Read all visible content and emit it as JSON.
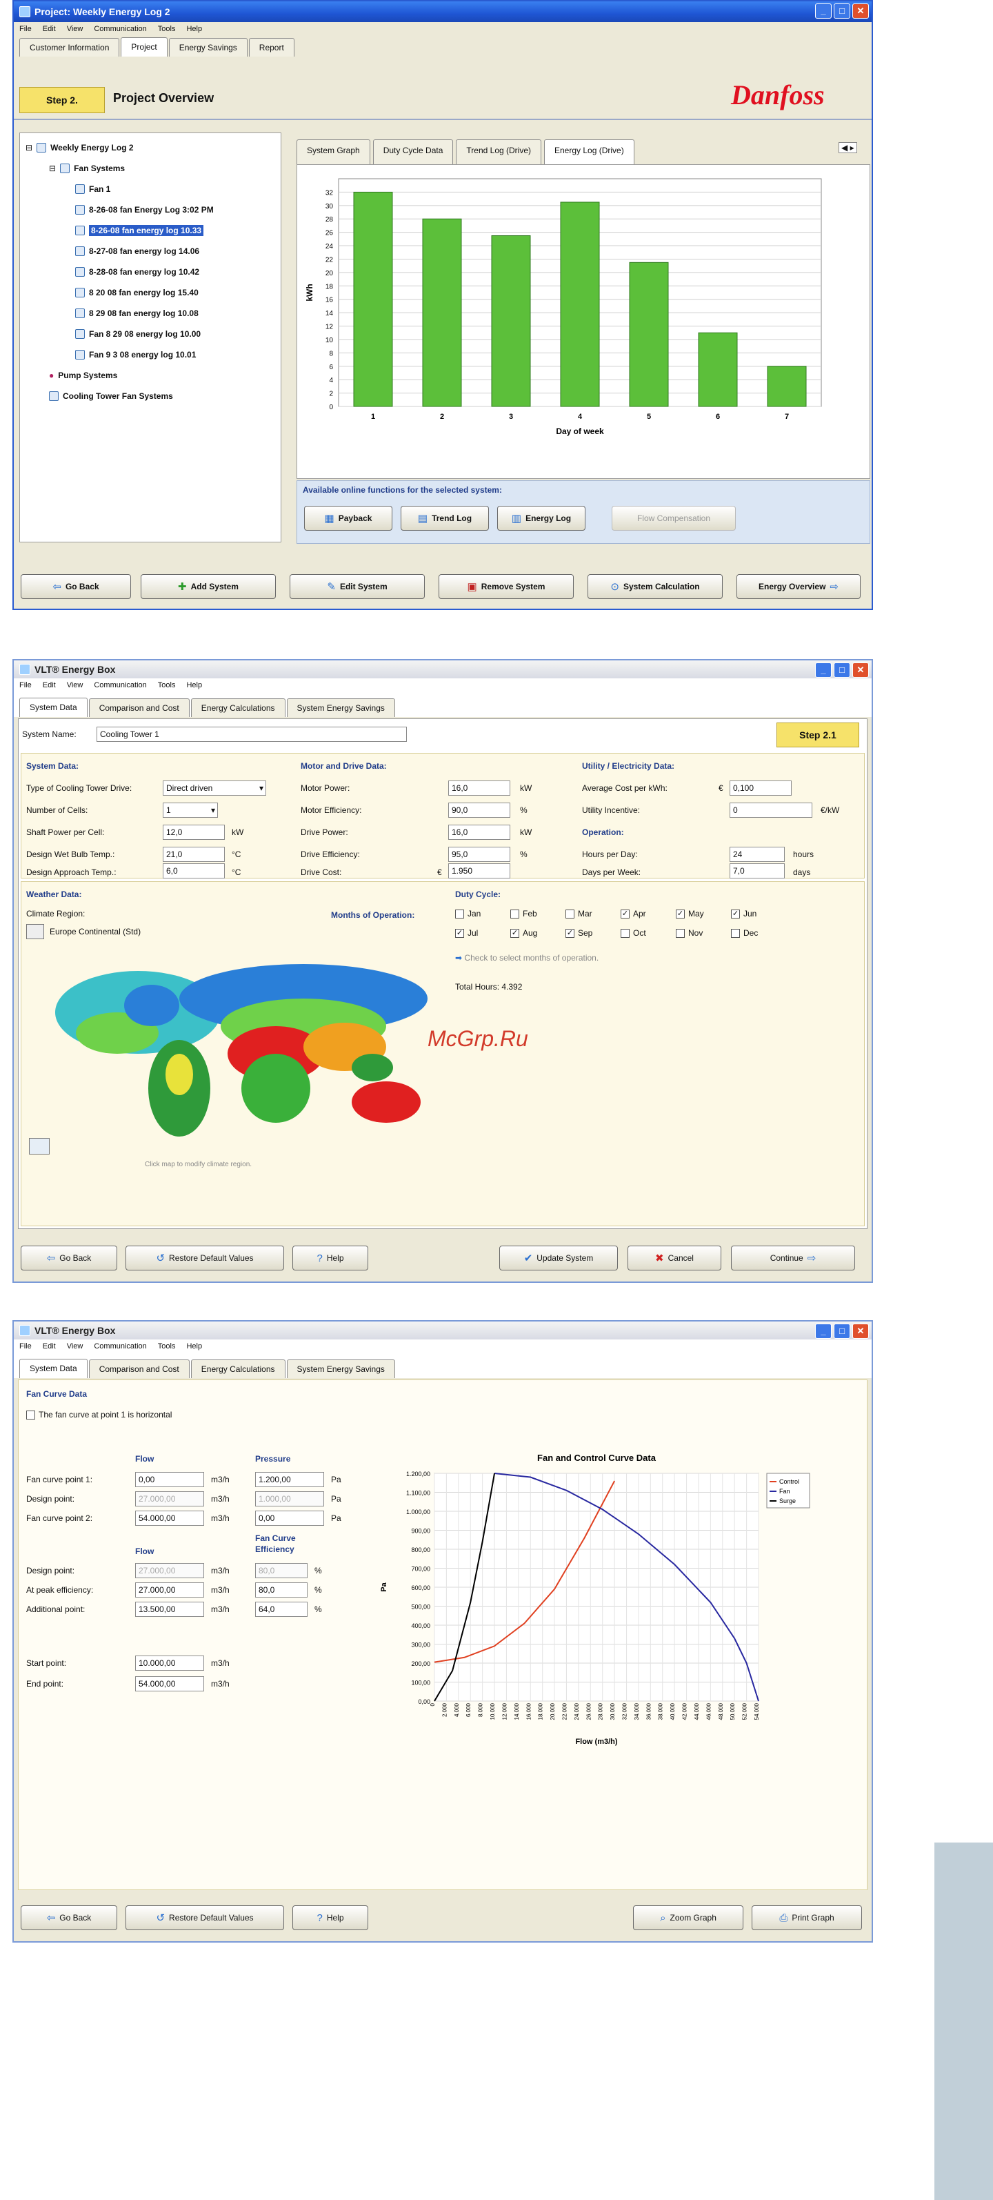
{
  "screen1": {
    "title": "Project: Weekly Energy Log 2",
    "menu": [
      "File",
      "Edit",
      "View",
      "Communication",
      "Tools",
      "Help"
    ],
    "tabs": [
      "Customer Information",
      "Project",
      "Energy Savings",
      "Report"
    ],
    "step": "Step 2.",
    "heading": "Project Overview",
    "logo": "Danfoss",
    "tree": {
      "root": "Weekly Energy Log 2",
      "fan_systems": "Fan Systems",
      "fan1": "Fan 1",
      "logs": [
        "8-26-08 fan Energy Log 3:02 PM",
        "8-26-08 fan energy log 10.33",
        "8-27-08 fan energy log 14.06",
        "8-28-08 fan energy log 10.42",
        "8 20 08 fan energy log 15.40",
        "8 29 08 fan energy log 10.08",
        "Fan 8 29 08 energy log 10.00",
        "Fan 9 3 08 energy log 10.01"
      ],
      "pump": "Pump Systems",
      "cooling": "Cooling Tower Fan Systems"
    },
    "graph_tabs": [
      "System Graph",
      "Duty Cycle Data",
      "Trend Log (Drive)",
      "Energy Log (Drive)"
    ],
    "functions_label": "Available online functions for the selected system:",
    "function_buttons": [
      "Payback",
      "Trend Log",
      "Energy Log",
      "Flow Compensation"
    ],
    "bottom_buttons": [
      "Go Back",
      "Add System",
      "Edit System",
      "Remove System",
      "System Calculation",
      "Energy Overview"
    ]
  },
  "chart_data": [
    {
      "type": "bar",
      "categories": [
        "1",
        "2",
        "3",
        "4",
        "5",
        "6",
        "7"
      ],
      "values": [
        32,
        28,
        25.5,
        30.5,
        21.5,
        11,
        6
      ],
      "xlabel": "Day of week",
      "ylabel": "kWh",
      "ylim": [
        0,
        34
      ],
      "yticks": [
        0,
        2,
        4,
        6,
        8,
        10,
        12,
        14,
        16,
        18,
        20,
        22,
        24,
        26,
        28,
        30,
        32
      ],
      "grid": true,
      "colors": {
        "bar": "#5cbf3a"
      }
    },
    {
      "type": "line",
      "title": "Fan and Control Curve Data",
      "xlabel": "Flow (m3/h)",
      "ylabel": "Pa",
      "xlim": [
        0,
        54000
      ],
      "ylim": [
        0,
        1200
      ],
      "xticks": [
        "0",
        "2.000",
        "4.000",
        "6.000",
        "8.000",
        "10.000",
        "12.000",
        "14.000",
        "16.000",
        "18.000",
        "20.000",
        "22.000",
        "24.000",
        "26.000",
        "28.000",
        "30.000",
        "32.000",
        "34.000",
        "36.000",
        "38.000",
        "40.000",
        "42.000",
        "44.000",
        "46.000",
        "48.000",
        "50.000",
        "52.000",
        "54.000"
      ],
      "yticks": [
        "0,00",
        "100,00",
        "200,00",
        "300,00",
        "400,00",
        "500,00",
        "600,00",
        "700,00",
        "800,00",
        "900,00",
        "1.000,00",
        "1.100,00",
        "1.200,00"
      ],
      "legend": "top-right",
      "series": [
        {
          "name": "Control",
          "color": "#e04020",
          "x": [
            0,
            5000,
            10000,
            15000,
            20000,
            25000,
            30000
          ],
          "y": [
            205,
            230,
            290,
            410,
            590,
            860,
            1160
          ]
        },
        {
          "name": "Fan",
          "color": "#2828a0",
          "x": [
            10000,
            16000,
            22000,
            28000,
            34000,
            40000,
            46000,
            50000,
            52000,
            54000
          ],
          "y": [
            1200,
            1180,
            1110,
            1010,
            880,
            720,
            520,
            330,
            200,
            0
          ]
        },
        {
          "name": "Surge",
          "color": "#000000",
          "x": [
            0,
            3000,
            6000,
            8000,
            10000
          ],
          "y": [
            0,
            160,
            520,
            840,
            1200
          ]
        }
      ]
    }
  ],
  "screen2": {
    "title": "VLT® Energy Box",
    "menu": [
      "File",
      "Edit",
      "View",
      "Communication",
      "Tools",
      "Help"
    ],
    "tabs": [
      "System Data",
      "Comparison and Cost",
      "Energy Calculations",
      "System Energy Savings"
    ],
    "system_name_label": "System Name:",
    "system_name": "Cooling Tower 1",
    "step": "Step 2.1",
    "system_data": {
      "header": "System Data:",
      "rows": [
        {
          "label": "Type of Cooling Tower Drive:",
          "value": "Direct driven",
          "unit": ""
        },
        {
          "label": "Number of Cells:",
          "value": "1",
          "unit": ""
        },
        {
          "label": "Shaft Power per Cell:",
          "value": "12,0",
          "unit": "kW"
        },
        {
          "label": "Design Wet Bulb Temp.:",
          "value": "21,0",
          "unit": "°C"
        },
        {
          "label": "Design Approach Temp.:",
          "value": "6,0",
          "unit": "°C"
        }
      ]
    },
    "motor_drive": {
      "header": "Motor and Drive Data:",
      "rows": [
        {
          "label": "Motor Power:",
          "value": "16,0",
          "unit": "kW"
        },
        {
          "label": "Motor Efficiency:",
          "value": "90,0",
          "unit": "%"
        },
        {
          "label": "Drive Power:",
          "value": "16,0",
          "unit": "kW"
        },
        {
          "label": "Drive Efficiency:",
          "value": "95,0",
          "unit": "%"
        },
        {
          "label": "Drive Cost:",
          "value": "1.950",
          "unit": "€"
        }
      ]
    },
    "utility": {
      "header": "Utility / Electricity Data:",
      "avg_label": "Average Cost per kWh:",
      "avg_value": "0,100",
      "currency": "€",
      "incentive_label": "Utility Incentive:",
      "incentive_value": "0",
      "incentive_unit": "€/kW",
      "operation_header": "Operation:",
      "hours_label": "Hours per Day:",
      "hours_value": "24",
      "hours_unit": "hours",
      "days_label": "Days per Week:",
      "days_value": "7,0",
      "days_unit": "days"
    },
    "weather": {
      "header": "Weather Data:",
      "climate_label": "Climate Region:",
      "climate_value": "Europe Continental (Std)",
      "map_hint": "Click map to modify climate region."
    },
    "duty": {
      "header": "Duty Cycle:",
      "months_label": "Months of Operation:",
      "months": [
        {
          "name": "Jan",
          "checked": false
        },
        {
          "name": "Feb",
          "checked": false
        },
        {
          "name": "Mar",
          "checked": false
        },
        {
          "name": "Apr",
          "checked": true
        },
        {
          "name": "May",
          "checked": true
        },
        {
          "name": "Jun",
          "checked": true
        },
        {
          "name": "Jul",
          "checked": true
        },
        {
          "name": "Aug",
          "checked": true
        },
        {
          "name": "Sep",
          "checked": true
        },
        {
          "name": "Oct",
          "checked": false
        },
        {
          "name": "Nov",
          "checked": false
        },
        {
          "name": "Dec",
          "checked": false
        }
      ],
      "hint": "Check to select months of operation.",
      "total_label": "Total Hours:",
      "total_value": "4.392"
    },
    "buttons": [
      "Go Back",
      "Restore Default Values",
      "Help",
      "Update System",
      "Cancel",
      "Continue"
    ]
  },
  "watermark": "McGrp.Ru",
  "screen3": {
    "title": "VLT® Energy Box",
    "menu": [
      "File",
      "Edit",
      "View",
      "Communication",
      "Tools",
      "Help"
    ],
    "tabs": [
      "System Data",
      "Comparison and Cost",
      "Energy Calculations",
      "System Energy Savings"
    ],
    "section": "Fan Curve Data",
    "horizontal_label": "The fan curve at point 1 is horizontal",
    "flow_header": "Flow",
    "pressure_header": "Pressure",
    "points": [
      {
        "label": "Fan curve point 1:",
        "flow": "0,00",
        "p": "1.200,00",
        "dis": false
      },
      {
        "label": "Design point:",
        "flow": "27.000,00",
        "p": "1.000,00",
        "dis": true
      },
      {
        "label": "Fan curve point 2:",
        "flow": "54.000,00",
        "p": "0,00",
        "dis": false
      }
    ],
    "flow_unit": "m3/h",
    "pressure_unit": "Pa",
    "flow_header2": "Flow",
    "eff_header": "Fan Curve Efficiency",
    "eff_points": [
      {
        "label": "Design point:",
        "flow": "27.000,00",
        "eff": "80,0",
        "dis": true
      },
      {
        "label": "At peak efficiency:",
        "flow": "27.000,00",
        "eff": "80,0",
        "dis": false
      },
      {
        "label": "Additional point:",
        "flow": "13.500,00",
        "eff": "64,0",
        "dis": false
      }
    ],
    "eff_unit": "%",
    "start_label": "Start point:",
    "start_value": "10.000,00",
    "end_label": "End point:",
    "end_value": "54.000,00",
    "buttons": [
      "Go Back",
      "Restore Default Values",
      "Help",
      "Zoom Graph",
      "Print Graph"
    ]
  }
}
